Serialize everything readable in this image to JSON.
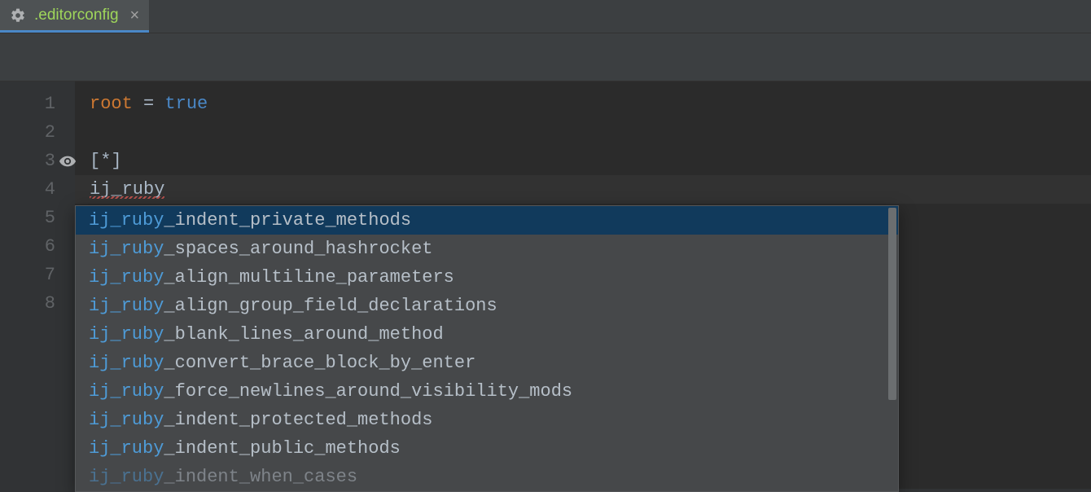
{
  "tab": {
    "filename": ".editorconfig"
  },
  "gutter": {
    "line_numbers": [
      "1",
      "2",
      "3",
      "4",
      "5",
      "6",
      "7",
      "8"
    ],
    "eye_at_line": 3
  },
  "code": {
    "l1_key": "root",
    "l1_op": " = ",
    "l1_val": "true",
    "l3_open": "[",
    "l3_glob": "*",
    "l3_close": "]",
    "l4_text": "ij_ruby"
  },
  "popup": {
    "match_prefix": "ij_ruby",
    "items": [
      "_indent_private_methods",
      "_spaces_around_hashrocket",
      "_align_multiline_parameters",
      "_align_group_field_declarations",
      "_blank_lines_around_method",
      "_convert_brace_block_by_enter",
      "_force_newlines_around_visibility_mods",
      "_indent_protected_methods",
      "_indent_public_methods",
      "_indent_when_cases"
    ],
    "selected_index": 0
  }
}
